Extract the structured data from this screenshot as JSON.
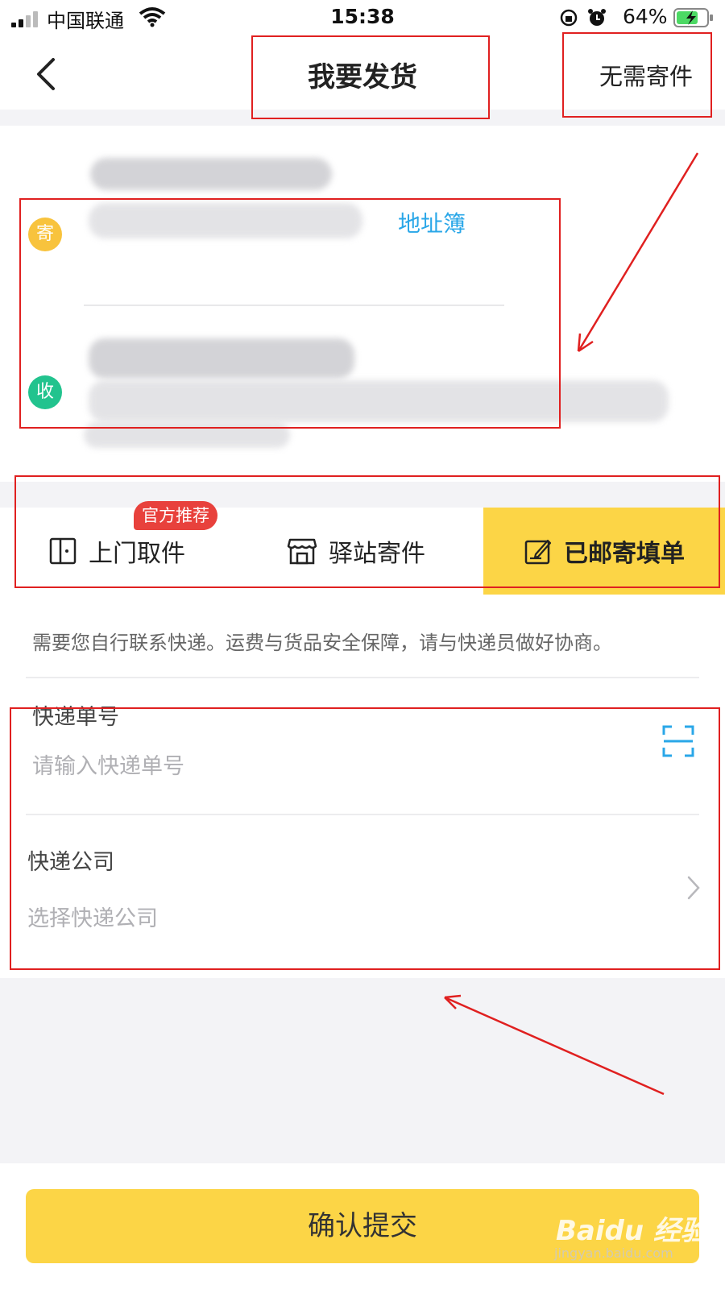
{
  "status_bar": {
    "carrier": "中国联通",
    "time": "15:38",
    "battery": "64%"
  },
  "nav": {
    "title": "我要发货",
    "right_action": "无需寄件"
  },
  "address": {
    "sender_badge": "寄",
    "receiver_badge": "收",
    "address_book_link": "地址簿"
  },
  "tabs": {
    "items": [
      {
        "label": "上门取件",
        "badge": "官方推荐",
        "icon": "door-icon",
        "active": false
      },
      {
        "label": "驿站寄件",
        "icon": "storefront-icon",
        "active": false
      },
      {
        "label": "已邮寄填单",
        "icon": "edit-form-icon",
        "active": true
      }
    ]
  },
  "form": {
    "notice": "需要您自行联系快递。运费与货品安全保障，请与快递员做好协商。",
    "tracking_label": "快递单号",
    "tracking_placeholder": "请输入快递单号",
    "tracking_scan_icon": "scan-icon",
    "company_label": "快递公司",
    "company_placeholder": "选择快递公司",
    "company_chevron_icon": "chevron-right-icon"
  },
  "submit": {
    "label": "确认提交"
  },
  "watermark": {
    "brand": "Baidu 经验",
    "url": "jingyan.baidu.com"
  },
  "colors": {
    "accent_yellow": "#fcd546",
    "link_blue": "#2aa7e8",
    "sender_badge": "#f8c33d",
    "receiver_badge": "#22c38e",
    "recommend_badge": "#e8413c",
    "annotation_red": "#e02020"
  }
}
